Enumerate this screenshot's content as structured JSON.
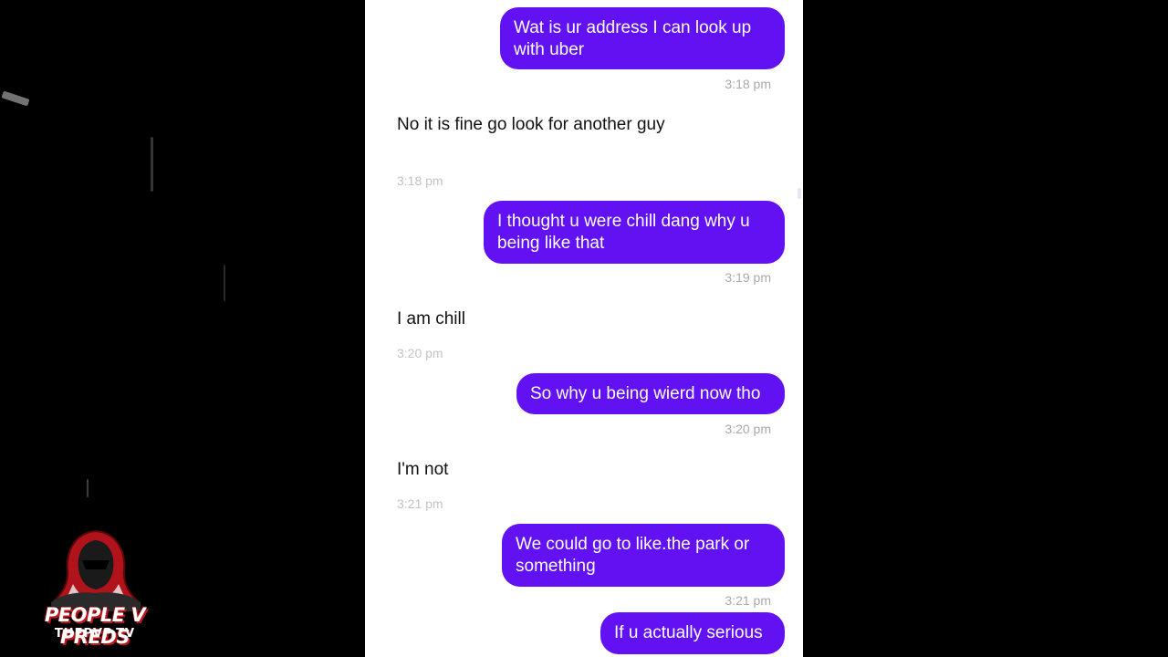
{
  "conversation": {
    "messages": [
      {
        "direction": "outgoing",
        "text": "Wat is ur address I can look up with uber",
        "time": "3:18 pm"
      },
      {
        "direction": "incoming",
        "text": "No it is fine go look for another guy",
        "time": "3:18 pm"
      },
      {
        "direction": "outgoing",
        "text": "I thought u were chill dang why u being like that",
        "time": "3:19 pm"
      },
      {
        "direction": "incoming",
        "text": "I am chill",
        "time": "3:20 pm"
      },
      {
        "direction": "outgoing",
        "text": "So why u being wierd now tho",
        "time": "3:20 pm"
      },
      {
        "direction": "incoming",
        "text": "I'm not",
        "time": "3:21 pm"
      },
      {
        "direction": "outgoing",
        "text": "We could go to like.the park or something",
        "time": "3:21 pm"
      },
      {
        "direction": "outgoing",
        "text": "If u actually serious",
        "time": ""
      }
    ]
  },
  "logo": {
    "title": "PEOPLE V PREDS",
    "subtitle": "THEPVP.TV",
    "icon": "hooded-figure-icon"
  },
  "colors": {
    "outgoing_bubble": "#6111f2",
    "incoming_text": "#111111",
    "timestamp": "#a9a9a9",
    "background": "#000000"
  }
}
